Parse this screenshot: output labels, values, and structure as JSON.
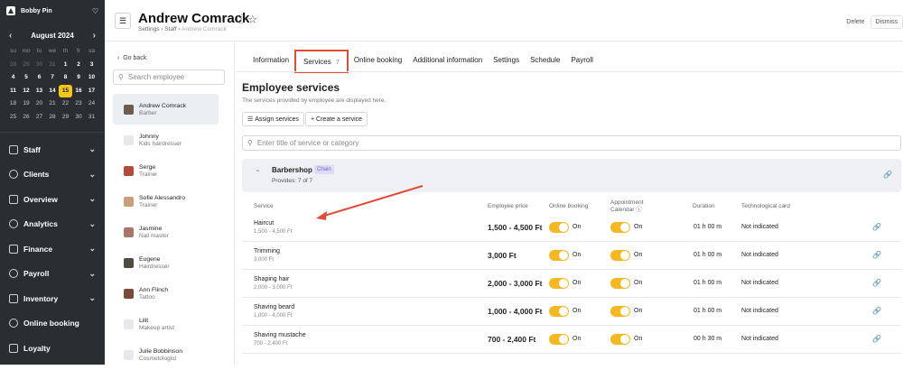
{
  "sidebar": {
    "user": "Bobby Pin",
    "calendar": {
      "month": "August 2024",
      "weekdays": [
        "su",
        "mo",
        "tu",
        "we",
        "th",
        "fr",
        "sa"
      ],
      "weeks": [
        [
          "28",
          "29",
          "30",
          "31",
          "1",
          "2",
          "3"
        ],
        [
          "4",
          "5",
          "6",
          "7",
          "8",
          "9",
          "10"
        ],
        [
          "11",
          "12",
          "13",
          "14",
          "15",
          "16",
          "17"
        ],
        [
          "18",
          "19",
          "20",
          "21",
          "22",
          "23",
          "24"
        ],
        [
          "25",
          "26",
          "27",
          "28",
          "29",
          "30",
          "31"
        ]
      ],
      "selected": "15"
    },
    "menu": [
      {
        "label": "Staff",
        "has_chevron": true
      },
      {
        "label": "Clients",
        "has_chevron": true
      },
      {
        "label": "Overview",
        "has_chevron": true
      },
      {
        "label": "Analytics",
        "has_chevron": true
      },
      {
        "label": "Finance",
        "has_chevron": true
      },
      {
        "label": "Payroll",
        "has_chevron": true
      },
      {
        "label": "Inventory",
        "has_chevron": true
      },
      {
        "label": "Online booking",
        "has_chevron": false
      },
      {
        "label": "Loyalty",
        "has_chevron": false
      }
    ]
  },
  "header": {
    "title": "Andrew Comrack",
    "breadcrumb": [
      "Settings",
      "Staff",
      "Andrew Comrack"
    ],
    "delete_label": "Delete",
    "dismiss_label": "Dismiss"
  },
  "employees": {
    "back_label": "Go back",
    "search_placeholder": "Search employee",
    "list": [
      {
        "name": "Andrew Comrack",
        "role": "Barber",
        "active": true,
        "avatar": "#6b5a4e"
      },
      {
        "name": "Johnny",
        "role": "Kids hairdresser",
        "active": false,
        "avatar": "#e6e8eb"
      },
      {
        "name": "Serge",
        "role": "Trainer",
        "active": false,
        "avatar": "#b44a3a"
      },
      {
        "name": "Sofie Alessandro",
        "role": "Trainer",
        "active": false,
        "avatar": "#c9a07a"
      },
      {
        "name": "Jasmine",
        "role": "Nail master",
        "active": false,
        "avatar": "#a8776a"
      },
      {
        "name": "Eugene",
        "role": "Hairdresser",
        "active": false,
        "avatar": "#4e4a44"
      },
      {
        "name": "Ann Flinch",
        "role": "Tattoo",
        "active": false,
        "avatar": "#7a4a3a"
      },
      {
        "name": "Lilit",
        "role": "Makeup artist",
        "active": false,
        "avatar": "#e6e8eb"
      },
      {
        "name": "Julie Bobbinson",
        "role": "Cosmetologist",
        "active": false,
        "avatar": "#e6e8eb"
      }
    ]
  },
  "tabs": [
    {
      "label": "Information"
    },
    {
      "label": "Services",
      "badge": "7"
    },
    {
      "label": "Online booking"
    },
    {
      "label": "Additional information"
    },
    {
      "label": "Settings"
    },
    {
      "label": "Schedule"
    },
    {
      "label": "Payroll"
    }
  ],
  "services": {
    "title": "Employee services",
    "subtitle": "The services provided by employee are displayed here.",
    "assign_label": "Assign services",
    "create_label": "Create a service",
    "filter_placeholder": "Enter title of service or category",
    "category": {
      "name": "Barbershop",
      "tag": "Chain",
      "provides": "Provides: 7 of 7"
    },
    "columns": {
      "service": "Service",
      "price": "Employee price",
      "online": "Online booking",
      "calendar": "Appointment Calendar",
      "duration": "Duration",
      "techcard": "Technological card"
    },
    "rows": [
      {
        "name": "Haircut",
        "range": "1,500 - 4,500 Ft",
        "price": "1,500 - 4,500 Ft",
        "online": "On",
        "calendar": "On",
        "duration": "01 h 00 m",
        "techcard": "Not indicated"
      },
      {
        "name": "Trimming",
        "range": "3,000 Ft",
        "price": "3,000 Ft",
        "online": "On",
        "calendar": "On",
        "duration": "01 h 00 m",
        "techcard": "Not indicated"
      },
      {
        "name": "Shaping hair",
        "range": "2,000 - 3,000 Ft",
        "price": "2,000 - 3,000 Ft",
        "online": "On",
        "calendar": "On",
        "duration": "01 h 00 m",
        "techcard": "Not indicated"
      },
      {
        "name": "Shaving beard",
        "range": "1,000 - 4,000 Ft",
        "price": "1,000 - 4,000 Ft",
        "online": "On",
        "calendar": "On",
        "duration": "01 h 00 m",
        "techcard": "Not indicated"
      },
      {
        "name": "Shaving mustache",
        "range": "700 - 2,400 Ft",
        "price": "700 - 2,400 Ft",
        "online": "On",
        "calendar": "On",
        "duration": "00 h 30 m",
        "techcard": "Not indicated"
      }
    ]
  },
  "colors": {
    "accent": "#f5b820",
    "annotation": "#e24c3a",
    "sidebar": "#2a2e33"
  }
}
